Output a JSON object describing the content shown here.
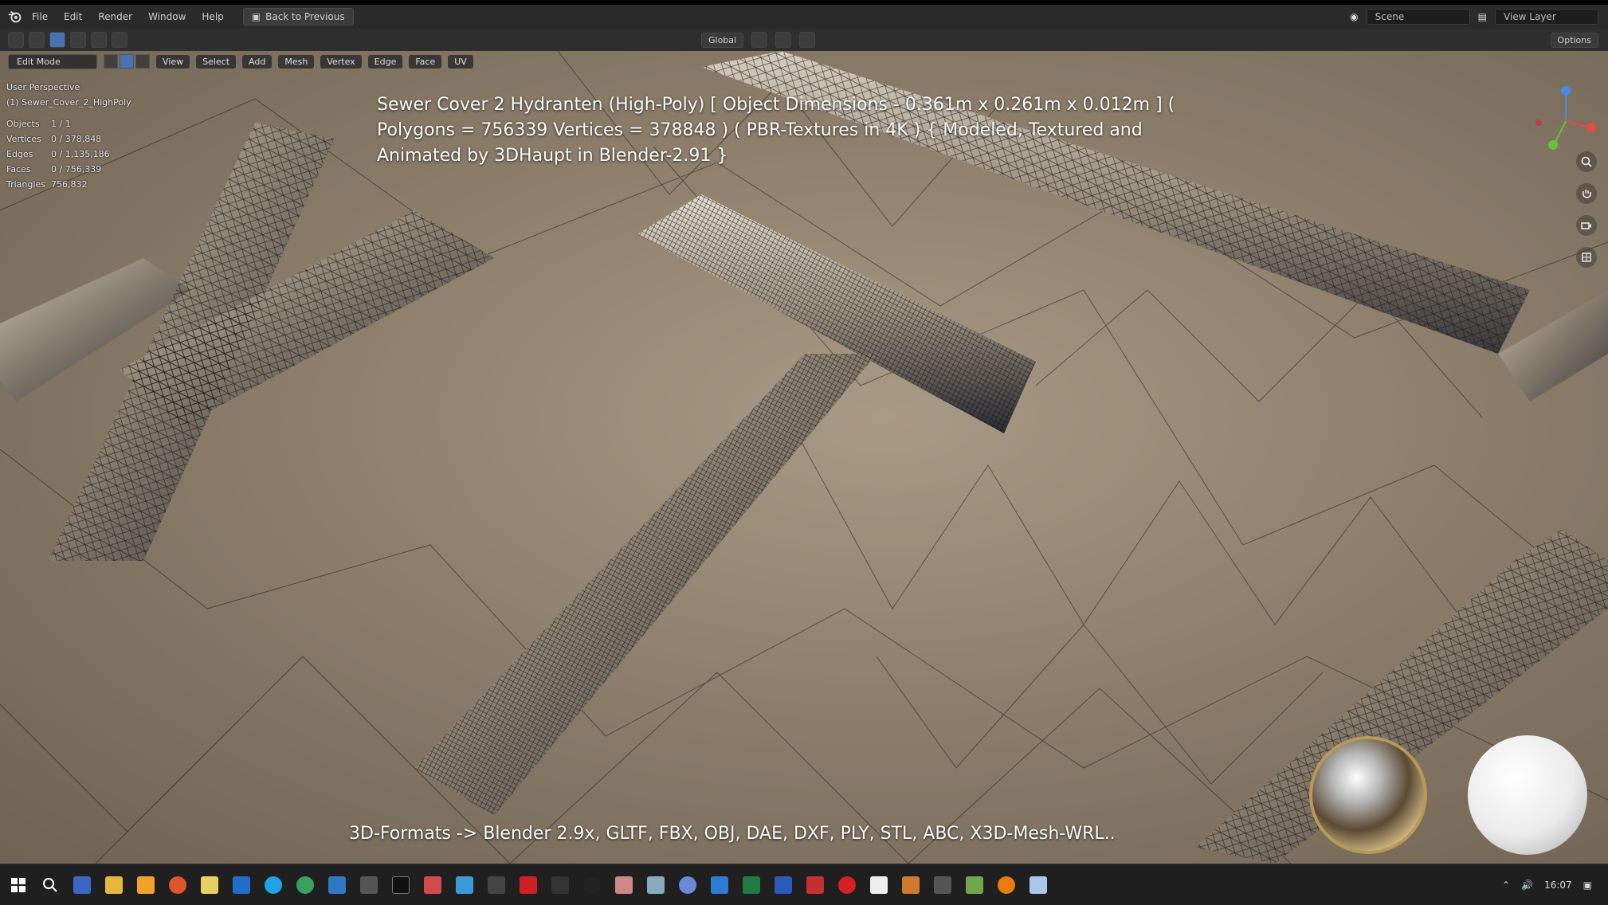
{
  "topbar": {
    "menu": [
      "File",
      "Edit",
      "Render",
      "Window",
      "Help"
    ],
    "back_button": "Back to Previous",
    "scene_field": "Scene",
    "view_layer": "View Layer"
  },
  "toolbar": {
    "orientation": "Global",
    "options": "Options"
  },
  "viewport_header": {
    "mode": "Edit Mode",
    "menus": [
      "View",
      "Select",
      "Add",
      "Mesh",
      "Vertex",
      "Edge",
      "Face",
      "UV"
    ]
  },
  "stats": {
    "perspective": "User Perspective",
    "object_name": "(1) Sewer_Cover_2_HighPoly",
    "rows": [
      {
        "label": "Objects",
        "value": "1 / 1"
      },
      {
        "label": "Vertices",
        "value": "0 / 378,848"
      },
      {
        "label": "Edges",
        "value": "0 / 1,135,186"
      },
      {
        "label": "Faces",
        "value": "0 / 756,339"
      },
      {
        "label": "Triangles",
        "value": "756,832"
      }
    ]
  },
  "overlay": {
    "title": "Sewer Cover 2 Hydranten (High-Poly) [ Object Dimensions -  0.361m x 0.261m x 0.012m ] ( Polygons = 756339 Vertices = 378848 ) ( PBR-Textures in 4K ) { Modeled, Textured and Animated by 3DHaupt in Blender-2.91 }",
    "formats": "3D-Formats -> Blender 2.9x, GLTF, FBX, OBJ, DAE, DXF, PLY, STL, ABC, X3D-Mesh-WRL.."
  },
  "taskbar": {
    "clock": "16:07"
  },
  "colors": {
    "accent": "#4772b3",
    "viewport_bg": "#9a8c78",
    "mesh_stroke": "#1a1610"
  }
}
